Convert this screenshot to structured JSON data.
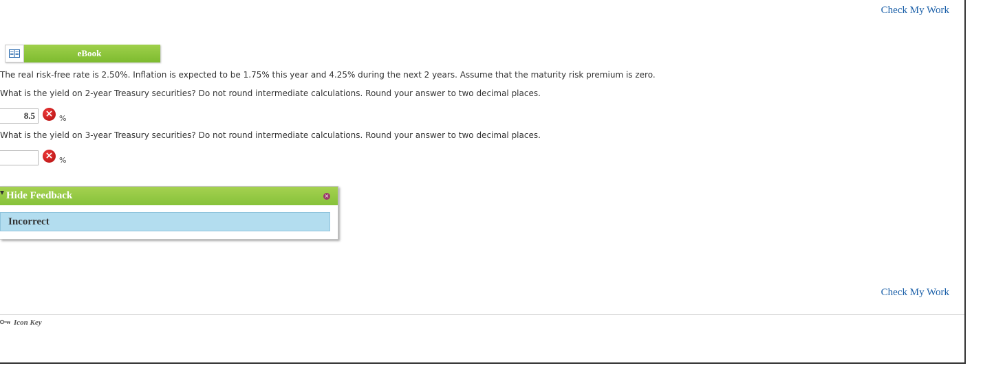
{
  "header": {
    "check_my_work_label": "Check My Work"
  },
  "ebook": {
    "label": "eBook",
    "icon": "book-icon"
  },
  "problem": {
    "statement": "The real risk-free rate is 2.50%. Inflation is expected to be 1.75% this year and 4.25% during the next 2 years. Assume that the maturity risk premium is zero.",
    "questions": [
      {
        "text": "What is the yield on 2-year Treasury securities? Do not round intermediate calculations. Round your answer to two decimal places.",
        "answer_value": "8.5",
        "unit": "%",
        "status_icon": "incorrect-x-icon"
      },
      {
        "text": "What is the yield on 3-year Treasury securities? Do not round intermediate calculations. Round your answer to two decimal places.",
        "answer_value": "",
        "unit": "%",
        "status_icon": "incorrect-x-icon"
      }
    ]
  },
  "feedback": {
    "title": "Hide Feedback",
    "message": "Incorrect",
    "close_icon": "close-icon"
  },
  "footer": {
    "check_my_work_label": "Check My Work",
    "icon_key_label": "Icon Key",
    "icon_key_icon": "key-icon"
  },
  "colors": {
    "accent_green": "#8cc63f",
    "link_blue": "#1a5fa8",
    "feedback_blue": "#b3ddef",
    "error_red": "#c81414"
  }
}
